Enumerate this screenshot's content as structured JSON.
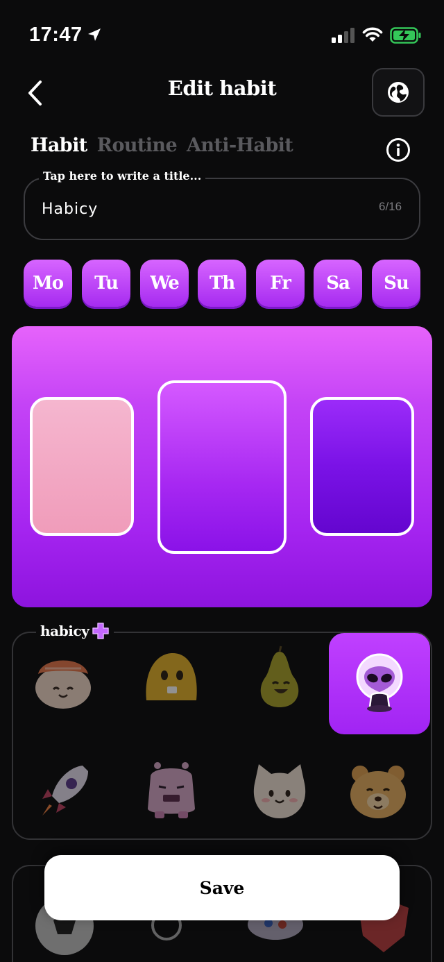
{
  "status_bar": {
    "time": "17:47"
  },
  "header": {
    "title": "Edit habit"
  },
  "tabs": [
    {
      "label": "Habit",
      "active": true
    },
    {
      "label": "Routine",
      "active": false
    },
    {
      "label": "Anti-Habit",
      "active": false
    }
  ],
  "title_field": {
    "legend": "Tap here to write a title...",
    "value": "Habicy",
    "counter": "6/16"
  },
  "days": [
    "Mo",
    "Tu",
    "We",
    "Th",
    "Fr",
    "Sa",
    "Su"
  ],
  "colors": {
    "accent": "#b238f5",
    "options": [
      {
        "name": "pink",
        "hex": "#f2a7c4"
      },
      {
        "name": "purple",
        "hex": "#b53cf7",
        "selected": true
      },
      {
        "name": "violet",
        "hex": "#7612e3"
      }
    ]
  },
  "stickers": {
    "legend": "habicy",
    "items": [
      {
        "name": "sushi",
        "selected": false
      },
      {
        "name": "yellow-blob",
        "selected": false
      },
      {
        "name": "pear",
        "selected": false
      },
      {
        "name": "alien",
        "selected": true
      },
      {
        "name": "rocket",
        "selected": false
      },
      {
        "name": "pink-monster",
        "selected": false
      },
      {
        "name": "cat",
        "selected": false
      },
      {
        "name": "bear",
        "selected": false
      }
    ]
  },
  "actions": {
    "save_label": "Save"
  }
}
